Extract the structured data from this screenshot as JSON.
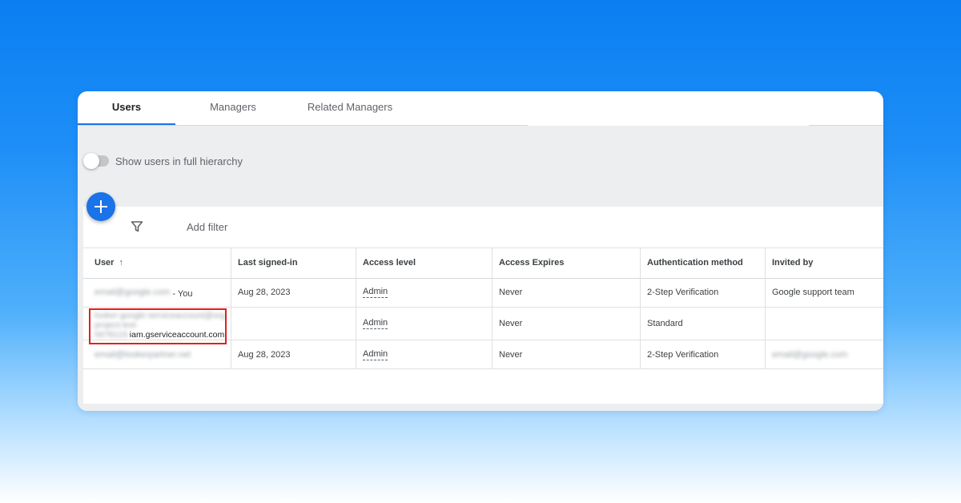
{
  "tabs": [
    {
      "label": "Users",
      "active": true
    },
    {
      "label": "Managers",
      "active": false
    },
    {
      "label": "Related Managers",
      "active": false
    }
  ],
  "toggle": {
    "label": "Show users in full hierarchy",
    "on": false
  },
  "toolbar": {
    "add_button_icon": "plus-icon",
    "filter_icon": "filter-icon",
    "add_filter_label": "Add filter"
  },
  "table": {
    "columns": [
      "User",
      "Last signed-in",
      "Access level",
      "Access Expires",
      "Authentication method",
      "Invited by"
    ],
    "sort": {
      "column": "User",
      "direction": "ascending",
      "icon": "arrow-up-icon"
    },
    "rows": [
      {
        "user": "email@google.com",
        "user_suffix": " - You",
        "last_signed_in": "Aug 28, 2023",
        "access_level": "Admin",
        "access_expires": "Never",
        "auth_method": "2-Step Verification",
        "invited_by": "Google support team"
      },
      {
        "user_line1": "looker-google-serviceaccount@org",
        "user_line2": "project-test",
        "user_line3_prefix": "5678123.",
        "user_line3": "iam.gserviceaccount.com",
        "last_signed_in": "",
        "access_level": "Admin",
        "access_expires": "Never",
        "auth_method": "Standard",
        "invited_by": ""
      },
      {
        "user": "email@lookerpartner.net",
        "last_signed_in": "Aug 28, 2023",
        "access_level": "Admin",
        "access_expires": "Never",
        "auth_method": "2-Step Verification",
        "invited_by": "email@google.com"
      }
    ]
  },
  "highlight_color": "#e02020",
  "accent_color": "#1a73e8"
}
